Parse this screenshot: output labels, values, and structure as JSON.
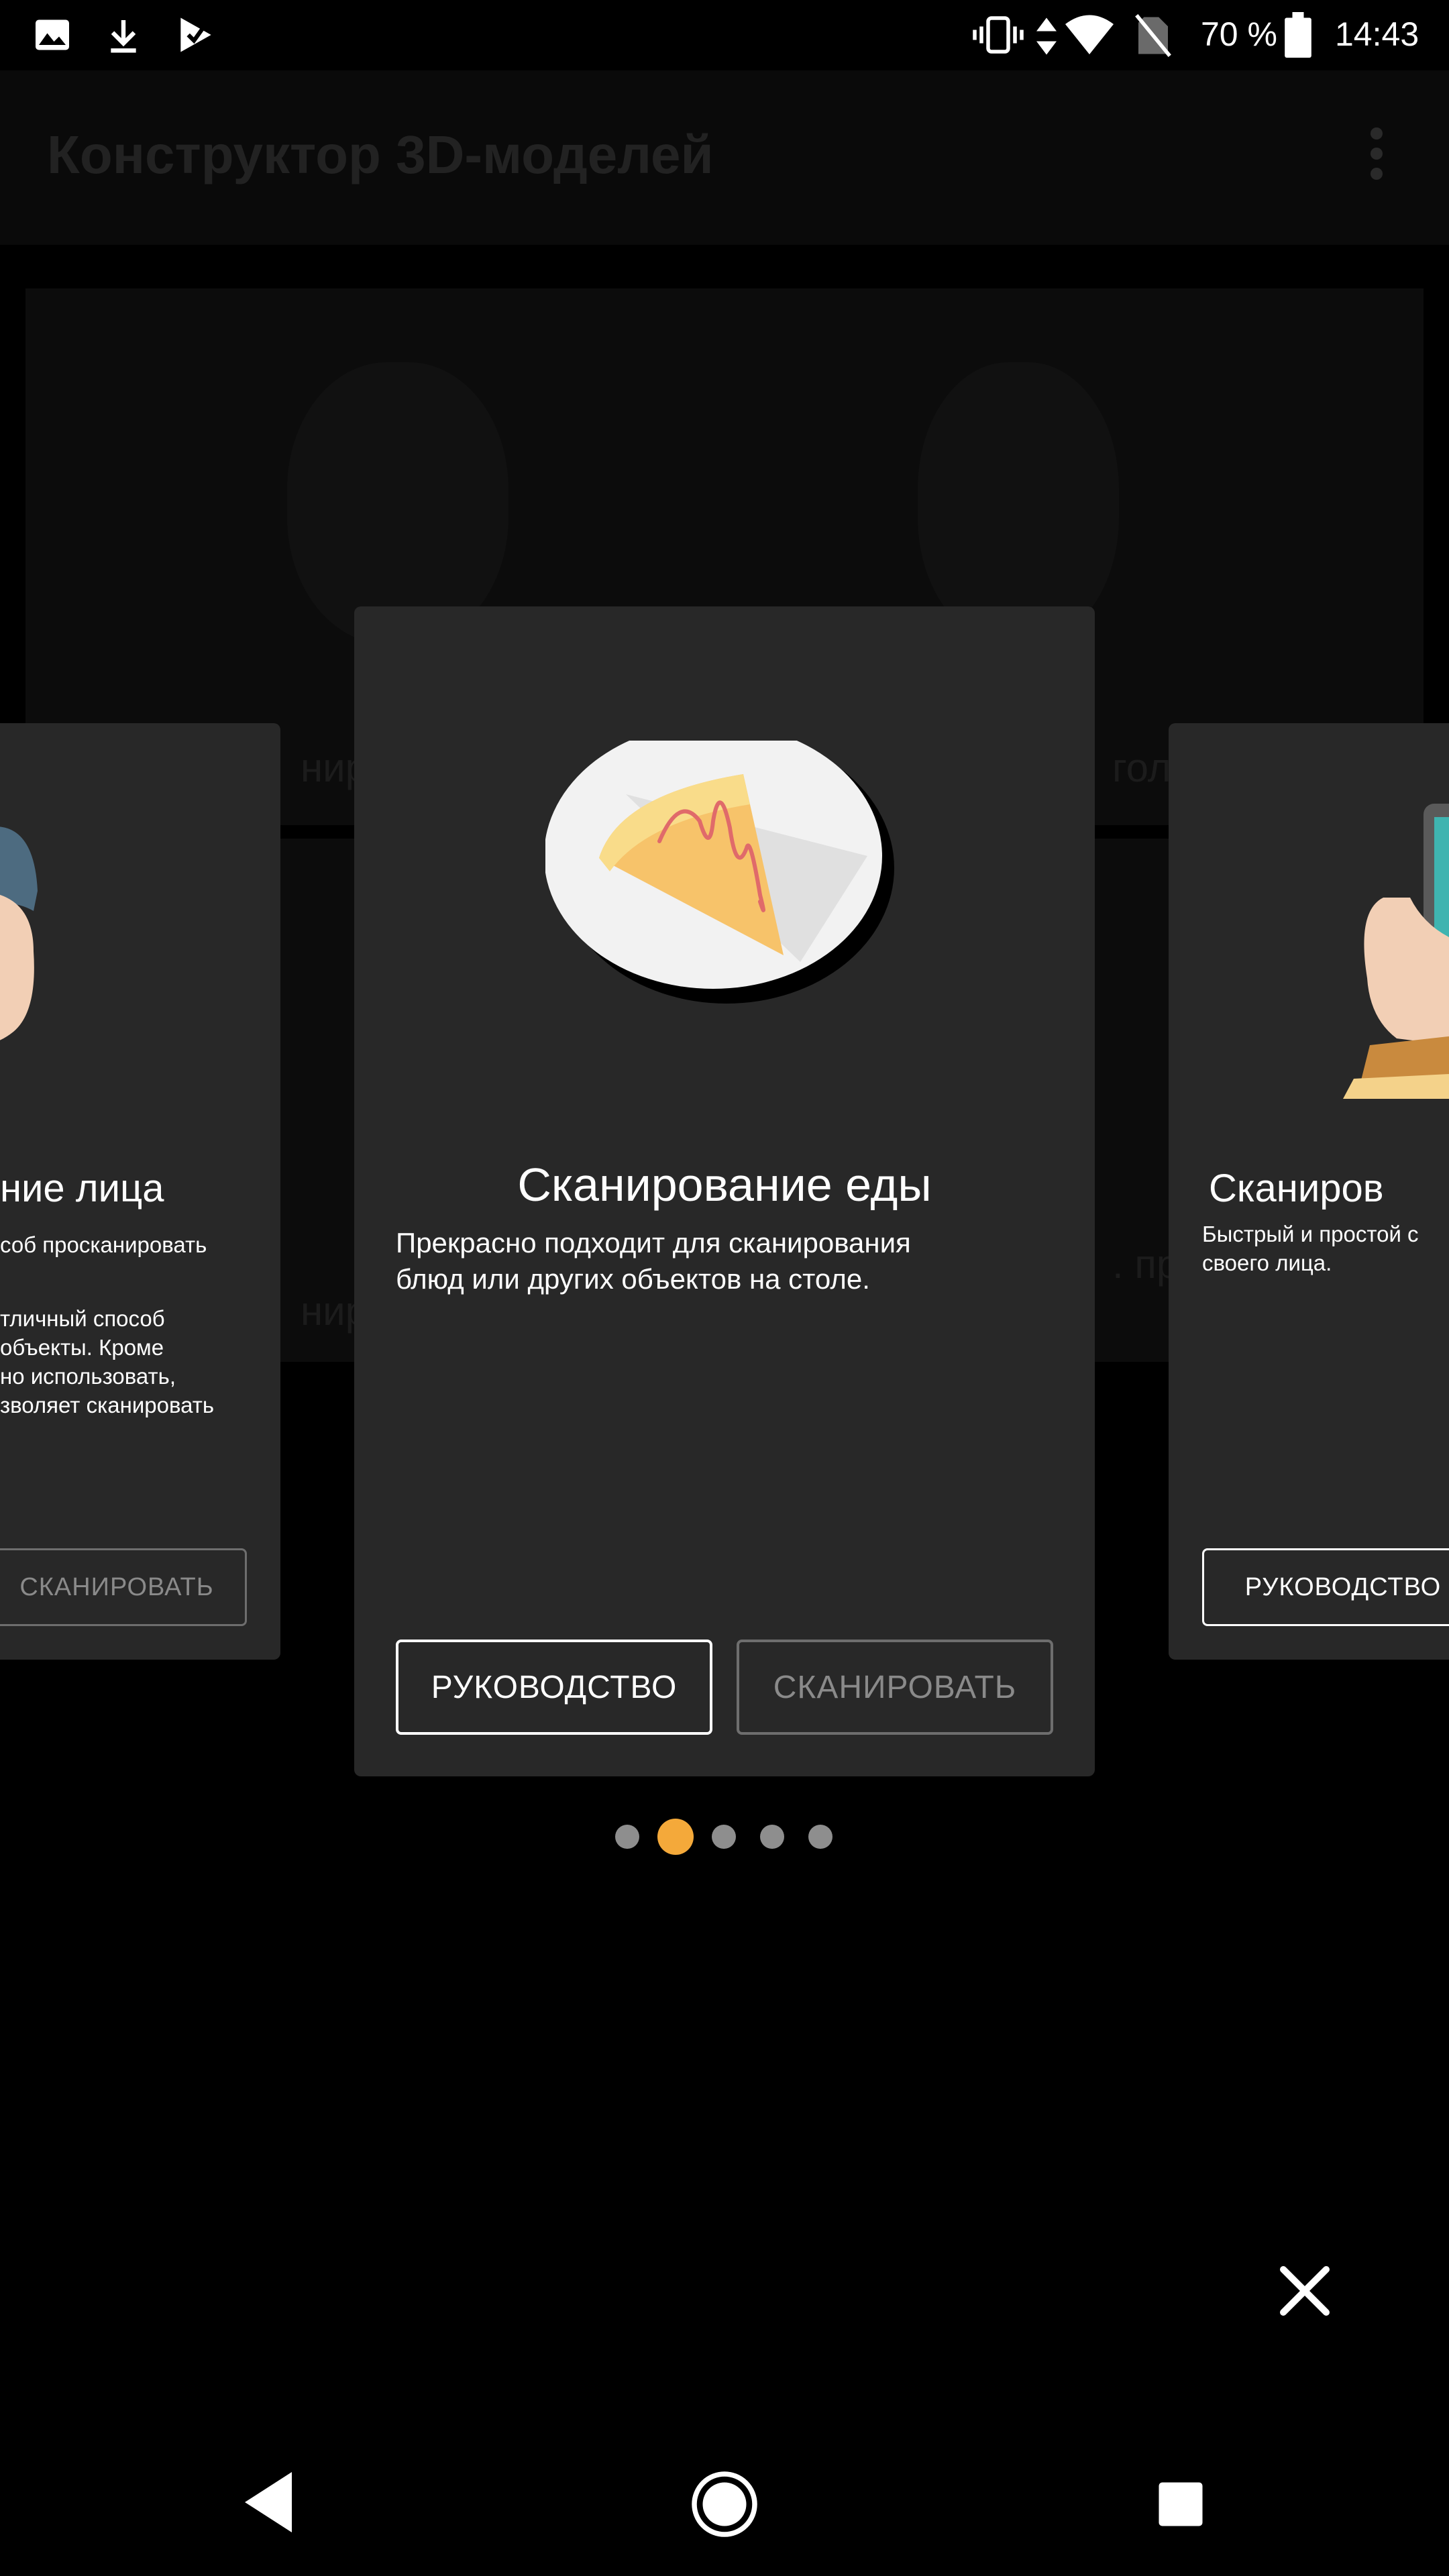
{
  "status_bar": {
    "battery_percent": "70 %",
    "time": "14:43",
    "icons": [
      "image-icon",
      "download-icon",
      "play-store-icon",
      "vibrate-icon",
      "data-arrows-icon",
      "wifi-icon",
      "no-sim-icon",
      "battery-icon"
    ]
  },
  "app": {
    "title": "Конструктор 3D-моделей",
    "overflow_icon": "more-vert-icon"
  },
  "background_tiles": {
    "tile1_fragment": "ниро",
    "tile2_fragment": "гол",
    "tile3_fragment": "ниро",
    "tile4_fragment": ". про"
  },
  "carousel": {
    "main_card": {
      "title": "Сканирование еды",
      "description_line1": "Прекрасно подходит для сканирования",
      "description_line2": "блюд или других объектов на столе.",
      "guide_label": "РУКОВОДСТВО",
      "scan_label": "СКАНИРОВАТЬ",
      "illustration": "pie-slice-on-plate"
    },
    "left_card": {
      "title": "ние лица",
      "desc_line1": "соб просканировать",
      "desc_line2": "тличный способ",
      "desc_line3": "объекты. Кроме",
      "desc_line4": "но использовать,",
      "desc_line5": "зволяет сканировать",
      "scan_label": "СКАНИРОВАТЬ",
      "illustration": "face-avatar"
    },
    "right_card": {
      "title": "Сканиров",
      "desc_line1": "Быстрый и простой с",
      "desc_line2": "своего лица.",
      "guide_label": "РУКОВОДСТВО",
      "illustration": "hand-with-phone"
    },
    "page_count": 5,
    "active_page": 2
  },
  "colors": {
    "accent": "#f4a93a",
    "card_bg": "#282828",
    "dot_inactive": "#8e8e8e"
  },
  "close_icon": "close-icon",
  "nav_bar": {
    "back": "back-icon",
    "home": "home-icon",
    "recents": "recents-icon"
  }
}
